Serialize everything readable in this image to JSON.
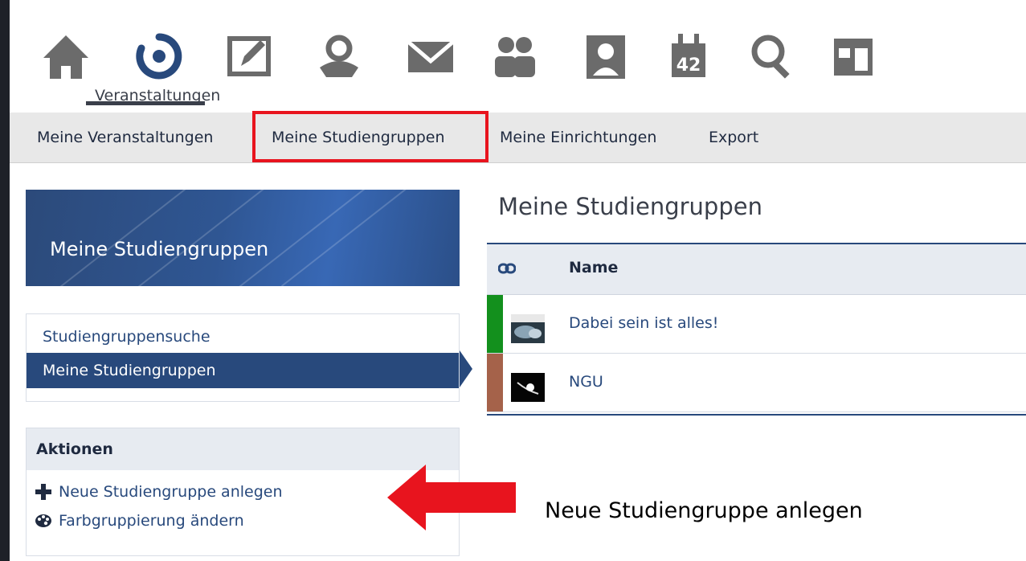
{
  "top_nav": {
    "icons": [
      {
        "name": "home-icon"
      },
      {
        "name": "courses-icon",
        "label": "Veranstaltungen",
        "active": true
      },
      {
        "name": "workspace-icon"
      },
      {
        "name": "community-icon"
      },
      {
        "name": "messages-icon"
      },
      {
        "name": "contacts-icon"
      },
      {
        "name": "profile-icon"
      },
      {
        "name": "calendar-icon",
        "badge": "42"
      },
      {
        "name": "search-icon"
      },
      {
        "name": "tools-icon"
      }
    ],
    "active_label": "Veranstaltungen"
  },
  "sub_nav": {
    "items": [
      "Meine Veranstaltungen",
      "Meine Studiengruppen",
      "Meine Einrichtungen",
      "Export"
    ],
    "highlighted_index": 1
  },
  "sidebar": {
    "header_title": "Meine Studiengruppen",
    "nav": [
      "Studiengruppensuche",
      "Meine Studiengruppen"
    ],
    "active_index": 1,
    "actions": {
      "heading": "Aktionen",
      "items": [
        {
          "icon": "plus-icon",
          "label": "Neue Studiengruppe anlegen"
        },
        {
          "icon": "palette-icon",
          "label": "Farbgruppierung ändern"
        }
      ]
    }
  },
  "main": {
    "title": "Meine Studiengruppen",
    "table": {
      "columns": [
        "Name"
      ],
      "rows": [
        {
          "name": "Dabei sein ist alles!",
          "color": "#13901d"
        },
        {
          "name": "NGU",
          "color": "#a5624a"
        }
      ]
    }
  },
  "annotation": {
    "text": "Neue Studiengruppe anlegen",
    "arrow_color": "#e8141e"
  },
  "colors": {
    "primary": "#28497c",
    "highlight": "#e8141e",
    "icon_gray": "#6b6b6b"
  }
}
